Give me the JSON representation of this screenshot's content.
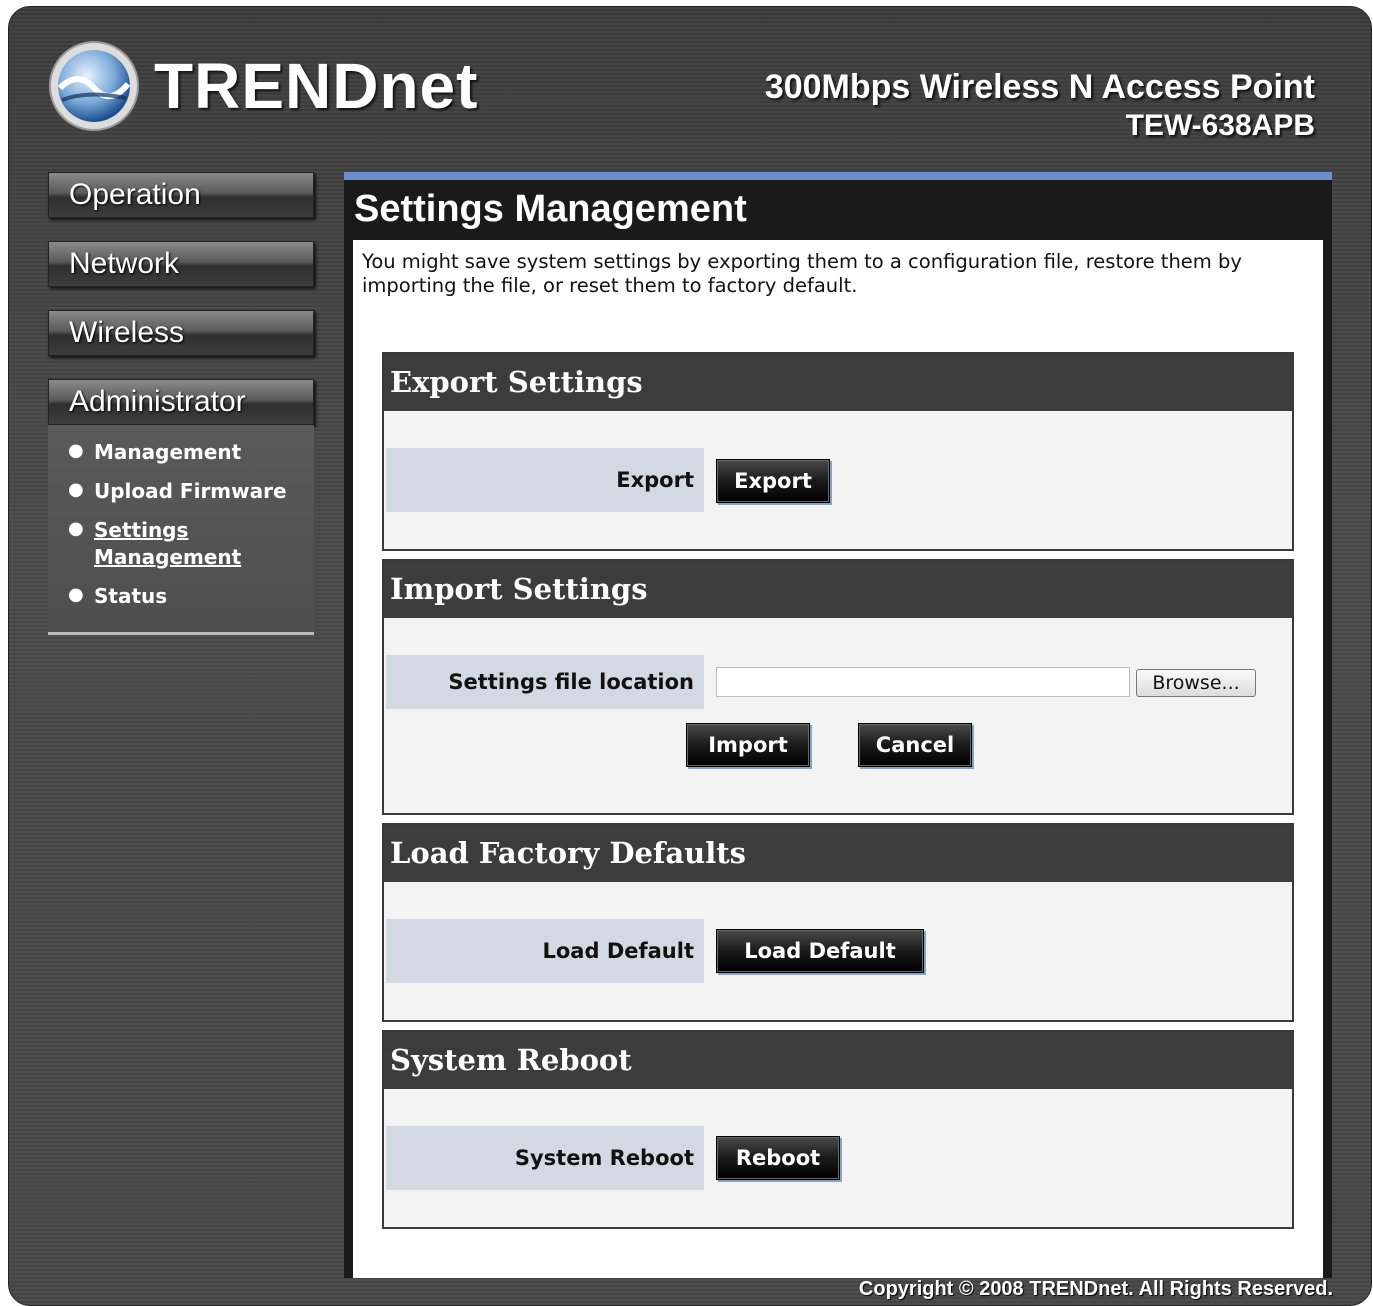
{
  "header": {
    "brand": "TRENDnet",
    "product_name": "300Mbps Wireless N Access Point",
    "model": "TEW-638APB"
  },
  "nav": {
    "operation": "Operation",
    "network": "Network",
    "wireless": "Wireless",
    "administrator": "Administrator",
    "submenu": {
      "management": "Management",
      "upload_firmware": "Upload Firmware",
      "settings_management": "Settings Management",
      "status": "Status"
    }
  },
  "page": {
    "title": "Settings Management",
    "intro": "You might save system settings by exporting them to a configuration file, restore them by importing the file, or reset them to factory default."
  },
  "export": {
    "header": "Export Settings",
    "label": "Export",
    "button": "Export"
  },
  "import": {
    "header": "Import Settings",
    "label": "Settings file location",
    "file_value": "",
    "browse": "Browse...",
    "import_button": "Import",
    "cancel_button": "Cancel"
  },
  "factory": {
    "header": "Load Factory Defaults",
    "label": "Load Default",
    "button": "Load Default"
  },
  "reboot": {
    "header": "System Reboot",
    "label": "System Reboot",
    "button": "Reboot"
  },
  "footer": {
    "copyright": "Copyright © 2008 TRENDnet. All Rights Reserved."
  },
  "colors": {
    "accent_bar": "#6d8fc9",
    "label_cell": "#d3d9e3",
    "section_header": "#3c3c3c"
  },
  "icons": {
    "logo": "trendnet-globe-logo-icon",
    "bullet": "bullet-icon"
  }
}
